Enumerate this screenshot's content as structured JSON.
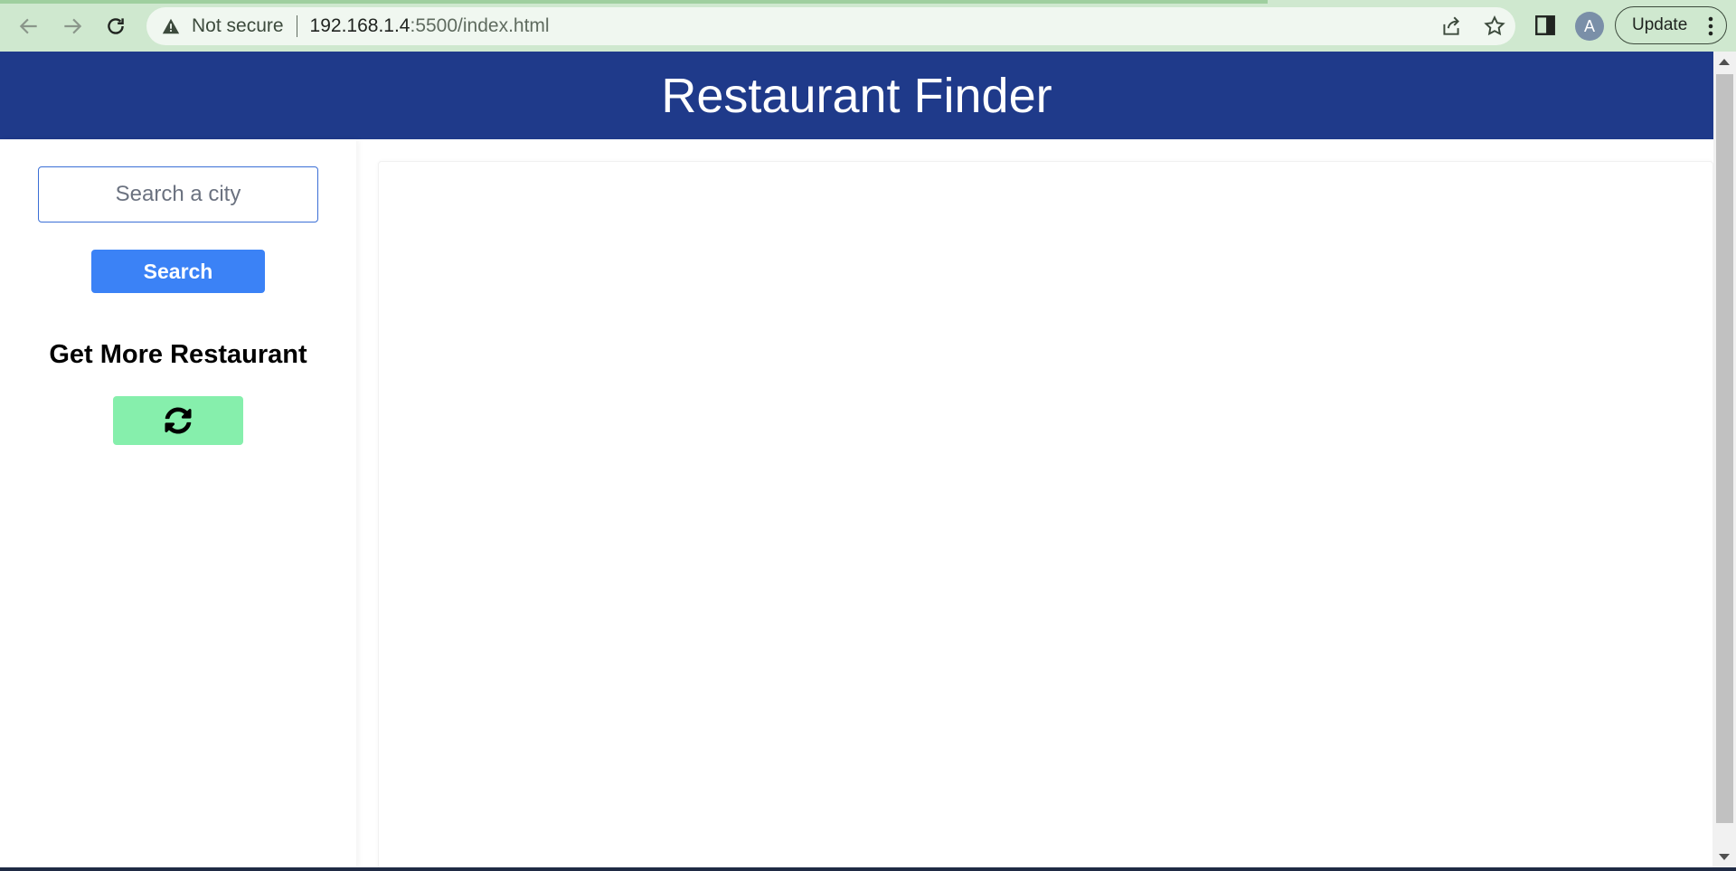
{
  "browser": {
    "security_text": "Not secure",
    "url_host": "192.168.1.4",
    "url_rest": ":5500/index.html",
    "profile_initial": "A",
    "update_label": "Update",
    "load_progress": 0.73
  },
  "header": {
    "title": "Restaurant Finder"
  },
  "sidebar": {
    "search_placeholder": "Search a city",
    "search_value": "",
    "search_button_label": "Search",
    "more_heading": "Get More Restaurant",
    "refresh_icon": "refresh-icon"
  },
  "colors": {
    "browser_bar": "#cfe8cf",
    "header_bg": "#1f3a8a",
    "search_button": "#3b82f6",
    "refresh_button": "#86efac"
  }
}
